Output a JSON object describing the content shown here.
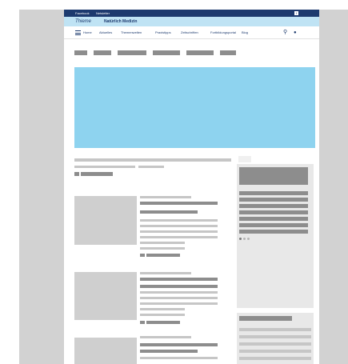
{
  "topbar": {
    "links": [
      "Facebook",
      "Netsletter"
    ],
    "social_icon": "facebook-icon"
  },
  "brand": {
    "logo_text": "Thieme",
    "tagline": "Natürlich Medizin"
  },
  "nav": {
    "menu_icon": "hamburger-icon",
    "items": [
      "Home",
      "Aktuelles",
      "Themenwelten",
      "Praxistipps",
      "Zeitschriften",
      "Fortbildungsportal",
      "Blog"
    ],
    "search_icon": "search-icon",
    "user_icon": "user-icon"
  },
  "colors": {
    "topbar": "#1d3a6e",
    "brandbar": "#bfe3f4",
    "hero": "#8ed3ef",
    "frame": "#d2d2d2",
    "placeholder_dark": "#8d8d8d",
    "placeholder_light": "#c6c6c6"
  }
}
